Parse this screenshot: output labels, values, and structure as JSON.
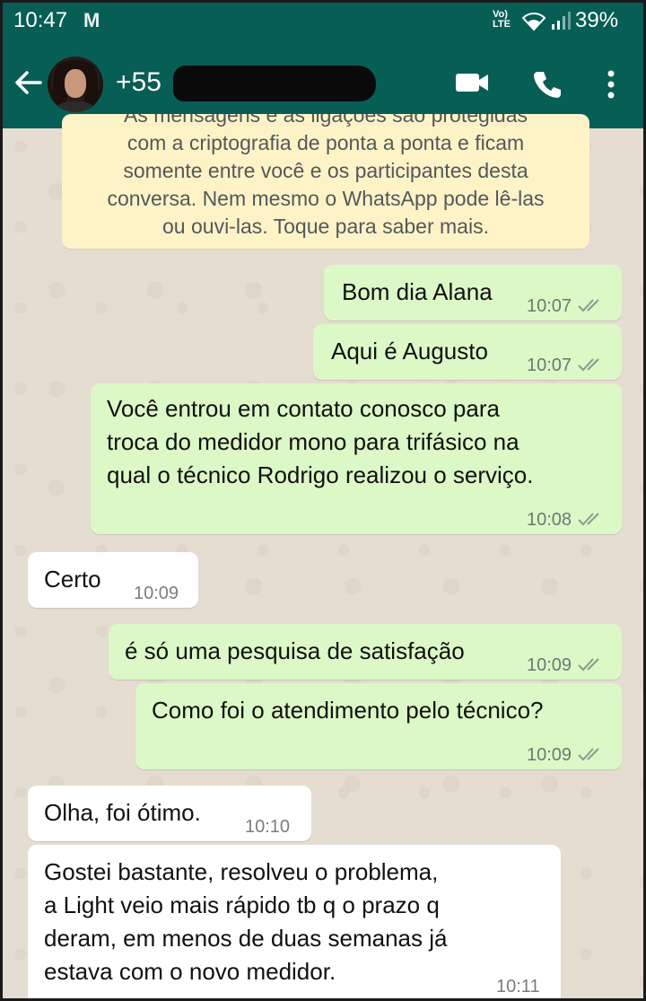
{
  "status_bar": {
    "time": "10:47",
    "notification": "M",
    "network": "VoLTE",
    "battery": "39%"
  },
  "header": {
    "contact": "+55",
    "colors": {
      "bar": "#075e54"
    },
    "icons": [
      "back-arrow-icon",
      "contact-avatar",
      "video-call-icon",
      "phone-icon",
      "more-options-icon"
    ]
  },
  "encryption_notice": {
    "lines": [
      "As mensagens e as ligações são protegidas",
      "com a criptografia de ponta a ponta e ficam",
      "somente entre você e os participantes desta",
      "conversa. Nem mesmo o WhatsApp pode lê-las",
      "ou ouvi-las. Toque para saber mais."
    ]
  },
  "messages": [
    {
      "dir": "out",
      "lines": [
        "Bom dia Alana"
      ],
      "time": "10:07",
      "read": true
    },
    {
      "dir": "out",
      "lines": [
        "Aqui é Augusto"
      ],
      "time": "10:07",
      "read": true
    },
    {
      "dir": "out",
      "lines": [
        "Você entrou em contato conosco para",
        "troca do medidor mono para trifásico na",
        "qual o técnico Rodrigo realizou o serviço."
      ],
      "time": "10:08",
      "read": true
    },
    {
      "dir": "in",
      "lines": [
        "Certo"
      ],
      "time": "10:09"
    },
    {
      "dir": "out",
      "lines": [
        "é só uma pesquisa de satisfação"
      ],
      "time": "10:09",
      "read": true
    },
    {
      "dir": "out",
      "lines": [
        "Como foi o atendimento pelo técnico?"
      ],
      "time": "10:09",
      "read": true
    },
    {
      "dir": "in",
      "lines": [
        "Olha, foi ótimo."
      ],
      "time": "10:10"
    },
    {
      "dir": "in",
      "lines": [
        "Gostei bastante, resolveu o problema,",
        "a Light veio mais rápido tb q o prazo q",
        "deram, em menos de duas semanas já",
        "estava com o novo medidor."
      ],
      "time": "10:11"
    }
  ],
  "colors": {
    "outgoing_bubble": "#dcf8c6",
    "incoming_bubble": "#ffffff",
    "notice_bg": "#fdf3c7",
    "read_ticks": "#8a9a90"
  }
}
